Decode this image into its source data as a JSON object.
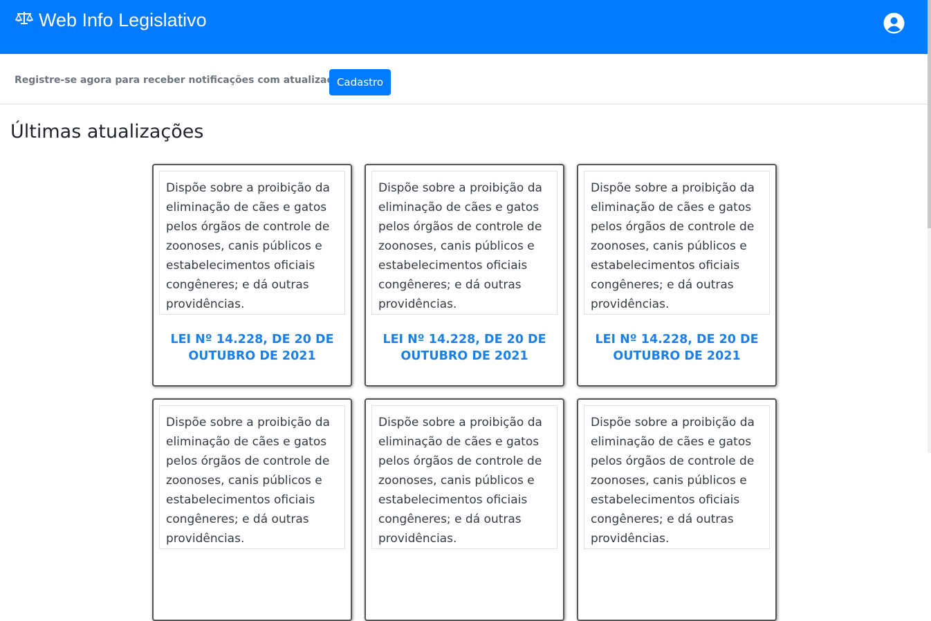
{
  "navbar": {
    "brand_icon": "balance-scale-icon",
    "brand": "Web Info Legislativo",
    "user_icon": "user-circle-icon",
    "color": "#007bff"
  },
  "register": {
    "text": "Registre-se agora para receber notificações com atualizações!",
    "button": "Cadastro"
  },
  "main": {
    "title": "Últimas atualizações",
    "cards": [
      {
        "description": "Dispõe sobre a proibição da eliminação de cães e gatos pelos órgãos de controle de zoonoses, canis públicos e estabelecimentos oficiais congêneres; e dá outras providências.",
        "law": "LEI Nº 14.228, DE 20 DE OUTUBRO DE 2021"
      },
      {
        "description": "Dispõe sobre a proibição da eliminação de cães e gatos pelos órgãos de controle de zoonoses, canis públicos e estabelecimentos oficiais congêneres; e dá outras providências.",
        "law": "LEI Nº 14.228, DE 20 DE OUTUBRO DE 2021"
      },
      {
        "description": "Dispõe sobre a proibição da eliminação de cães e gatos pelos órgãos de controle de zoonoses, canis públicos e estabelecimentos oficiais congêneres; e dá outras providências.",
        "law": "LEI Nº 14.228, DE 20 DE OUTUBRO DE 2021"
      },
      {
        "description": "Dispõe sobre a proibição da eliminação de cães e gatos pelos órgãos de controle de zoonoses, canis públicos e estabelecimentos oficiais congêneres; e dá outras providências.",
        "law": ""
      },
      {
        "description": "Dispõe sobre a proibição da eliminação de cães e gatos pelos órgãos de controle de zoonoses, canis públicos e estabelecimentos oficiais congêneres; e dá outras providências.",
        "law": ""
      },
      {
        "description": "Dispõe sobre a proibição da eliminação de cães e gatos pelos órgãos de controle de zoonoses, canis públicos e estabelecimentos oficiais congêneres; e dá outras providências.",
        "law": ""
      }
    ]
  }
}
